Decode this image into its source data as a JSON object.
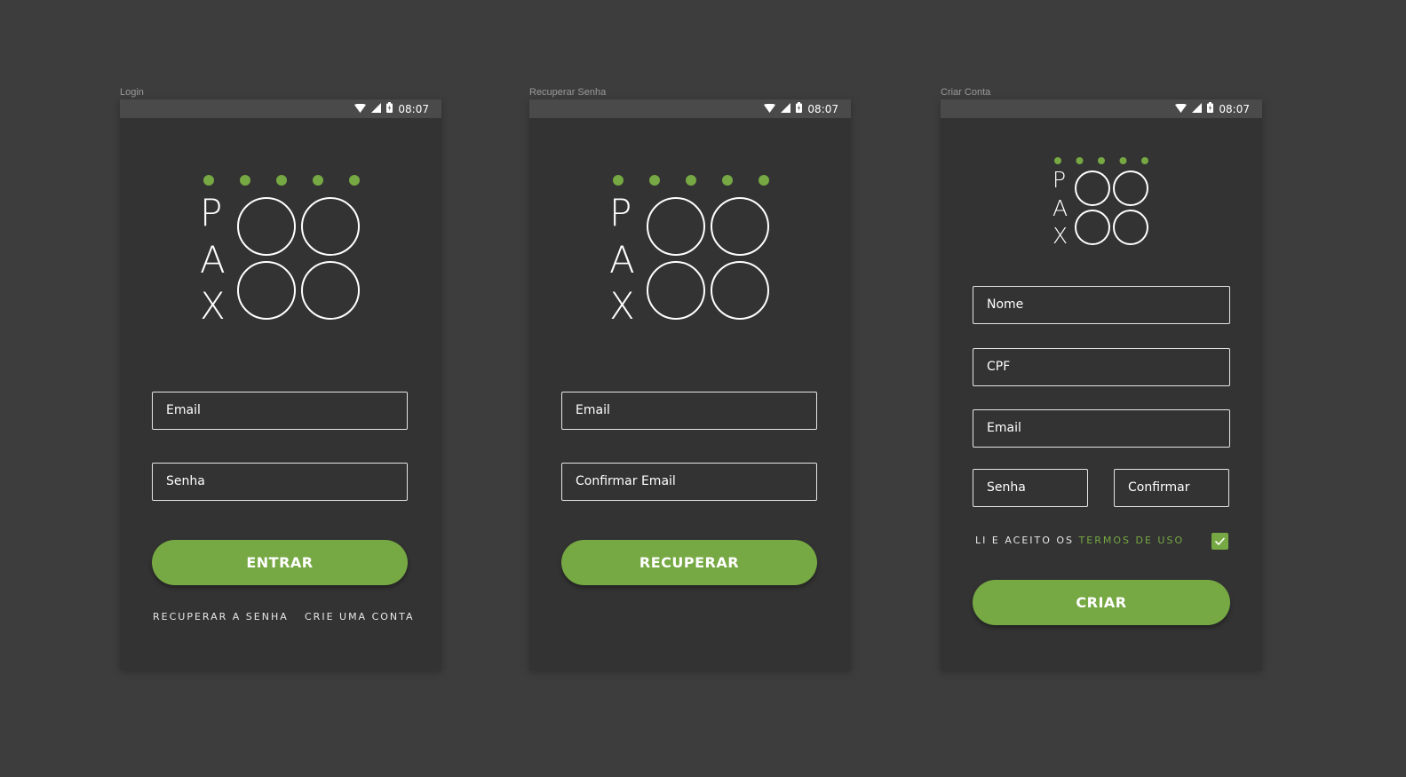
{
  "colors": {
    "background": "#3d3d3d",
    "screen": "#333333",
    "accent": "#76a843",
    "statusbar": "#4a4a4a"
  },
  "status": {
    "time": "08:07",
    "icons": [
      "wifi-icon",
      "signal-icon",
      "battery-icon"
    ]
  },
  "logo": {
    "letters": [
      "P",
      "A",
      "X"
    ]
  },
  "login": {
    "label": "Login",
    "email_placeholder": "Email",
    "password_placeholder": "Senha",
    "submit": "ENTRAR",
    "recover_link": "RECUPERAR A SENHA",
    "create_link": "CRIE UMA CONTA"
  },
  "recover": {
    "label": "Recuperar Senha",
    "email_placeholder": "Email",
    "confirm_email_placeholder": "Confirmar Email",
    "submit": "RECUPERAR"
  },
  "create": {
    "label": "Criar Conta",
    "name_placeholder": "Nome",
    "cpf_placeholder": "CPF",
    "email_placeholder": "Email",
    "password_placeholder": "Senha",
    "confirm_placeholder": "Confirmar",
    "terms_prefix": "LI E ACEITO OS ",
    "terms_link": "TERMOS DE USO",
    "terms_checked": true,
    "submit": "CRIAR"
  }
}
